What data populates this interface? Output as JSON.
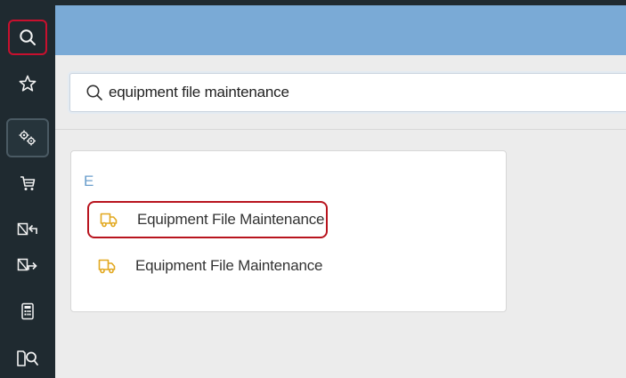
{
  "sidebar": {
    "items": [
      {
        "name": "search",
        "icon": "search-icon"
      },
      {
        "name": "favorites",
        "icon": "star-icon"
      },
      {
        "name": "settings",
        "icon": "gears-icon"
      },
      {
        "name": "cart",
        "icon": "cart-icon"
      },
      {
        "name": "returns",
        "icon": "return-icon"
      },
      {
        "name": "transfer",
        "icon": "transfer-icon"
      },
      {
        "name": "calculator",
        "icon": "calculator-icon"
      },
      {
        "name": "document-search",
        "icon": "document-search-icon"
      }
    ]
  },
  "search": {
    "value": "equipment file maintenance"
  },
  "results": {
    "group_letter": "E",
    "items": [
      {
        "label": "Equipment File Maintenance",
        "icon": "truck-icon"
      },
      {
        "label": "Equipment File Maintenance",
        "icon": "truck-icon"
      }
    ]
  },
  "colors": {
    "sidebar_bg": "#1f2a30",
    "header_bg": "#7aaad6",
    "highlight_red": "#c8102e",
    "truck_icon": "#e2a81f",
    "group_letter": "#6b9ecb"
  }
}
